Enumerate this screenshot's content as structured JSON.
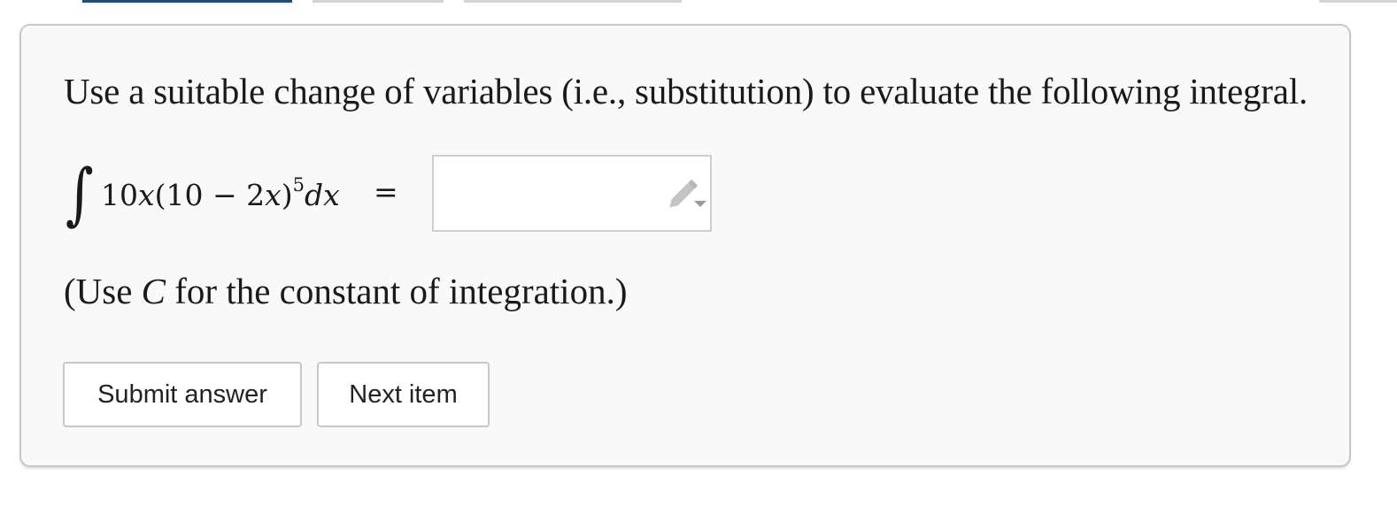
{
  "question": {
    "prompt": "Use a suitable change of variables (i.e., substitution) to evaluate the following integral.",
    "integral_sign": "∫",
    "integrand_coef": "10",
    "integrand_var": "x",
    "integrand_inner": "(10 − 2",
    "integrand_inner_var": "x",
    "integrand_close": ")",
    "integrand_exponent": "5",
    "differential": "dx",
    "equals": "=",
    "answer_value": "",
    "note_prefix": "(Use ",
    "note_constant": "C",
    "note_suffix": " for the constant of integration.)"
  },
  "buttons": {
    "submit_label": "Submit answer",
    "next_label": "Next item"
  },
  "icons": {
    "answer_tool": "pencil-dropdown-icon"
  },
  "colors": {
    "card_bg": "#f9f9f9",
    "card_border": "#c8c8c8",
    "active_tab": "#1f4e79"
  }
}
